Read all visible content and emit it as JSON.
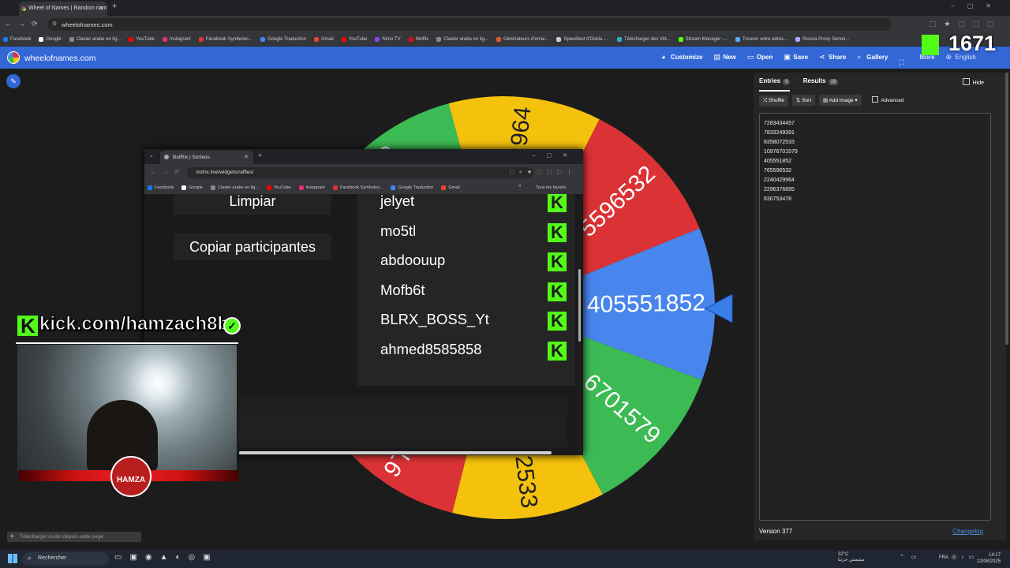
{
  "browser": {
    "tab_title": "Wheel of Names | Random nam",
    "url": "wheelofnames.com",
    "bookmarks": [
      {
        "label": "Facebook",
        "color": "#1877f2"
      },
      {
        "label": "Google",
        "color": "#ffffff"
      },
      {
        "label": "Clavier arabe en lig...",
        "color": "#888888"
      },
      {
        "label": "YouTube",
        "color": "#ff0000"
      },
      {
        "label": "Instagram",
        "color": "#e1306c"
      },
      {
        "label": "Facebook Symboles...",
        "color": "#d33"
      },
      {
        "label": "Google Traduction",
        "color": "#4285f4"
      },
      {
        "label": "Gmail",
        "color": "#ea4335"
      },
      {
        "label": "YouTube",
        "color": "#ff0000"
      },
      {
        "label": "Nimo TV",
        "color": "#8844ee"
      },
      {
        "label": "Netflix",
        "color": "#e50914"
      },
      {
        "label": "Clavier arabe en lig...",
        "color": "#888888"
      },
      {
        "label": "Générateurs d'emai...",
        "color": "#dd5533"
      },
      {
        "label": "Speedtest d'Ookla -...",
        "color": "#cccccc"
      },
      {
        "label": "Télécharger des Vid...",
        "color": "#33aacc"
      },
      {
        "label": "Stream Manager -...",
        "color": "#53fc18"
      },
      {
        "label": "Trouver votre adres...",
        "color": "#55aaff"
      },
      {
        "label": "Russia Proxy Server...",
        "color": "#aaaaff"
      }
    ]
  },
  "won": {
    "site": "wheelofnames.com",
    "menu": [
      {
        "label": "Customize",
        "icon": "palette-icon",
        "glyph": "◕"
      },
      {
        "label": "New",
        "icon": "file-icon",
        "glyph": "▤"
      },
      {
        "label": "Open",
        "icon": "folder-icon",
        "glyph": "▭"
      },
      {
        "label": "Save",
        "icon": "save-icon",
        "glyph": "▣"
      },
      {
        "label": "Share",
        "icon": "share-icon",
        "glyph": "⋖"
      },
      {
        "label": "Gallery",
        "icon": "search-icon",
        "glyph": "⌕"
      },
      {
        "label": "",
        "icon": "fullscreen-icon",
        "glyph": "⛶"
      },
      {
        "label": "More",
        "icon": "chevron-down-icon",
        "glyph": ""
      },
      {
        "label": "English",
        "icon": "globe-icon",
        "glyph": "⊕"
      }
    ],
    "kick_count": "1671"
  },
  "wheel": {
    "slices": [
      {
        "label": "7283434457",
        "color": "#db3236"
      },
      {
        "label": "7833249391",
        "color": "#f4c20d"
      },
      {
        "label": "8358072533",
        "color": "#3cba54"
      },
      {
        "label": "10976701579",
        "color": "#4885ed"
      },
      {
        "label": "405551852",
        "color": "#db3236"
      },
      {
        "label": "765596532",
        "color": "#f4c20d"
      },
      {
        "label": "2240429964",
        "color": "#3cba54"
      },
      {
        "label": "2296376895",
        "color": "#4885ed"
      },
      {
        "label": "830753478",
        "color": "#3cba54"
      }
    ],
    "winner": "405551852",
    "visible_fragments": {
      "top": "964",
      "left_top": "56",
      "red_right": "5596532",
      "blue_winner": "405551852",
      "green_right": "6701579",
      "bottom_yellow": "2533",
      "bottom_red": "L6"
    }
  },
  "panel": {
    "tab_entries": "Entries",
    "entries_count": "9",
    "tab_results": "Results",
    "results_count": "18",
    "hide": "Hide",
    "shuffle": "Shuffle",
    "sort": "Sort",
    "add_image": "Add image",
    "advanced": "Advanced",
    "entries": [
      "7283434457",
      "7833249391",
      "8358072533",
      "10976701579",
      "405551852",
      "765596532",
      "2240429964",
      "2296376895",
      "830753478"
    ],
    "version": "Version 377",
    "changelog": "Changelog"
  },
  "popup": {
    "tab_title": "BotRix | Sorteos",
    "url": "botrix.live/widgets/raffles/",
    "bookmarks": [
      {
        "label": "Facebook",
        "color": "#1877f2"
      },
      {
        "label": "Google",
        "color": "#ffffff"
      },
      {
        "label": "Clavier arabe en lig...",
        "color": "#888888"
      },
      {
        "label": "YouTube",
        "color": "#ff0000"
      },
      {
        "label": "Instagram",
        "color": "#e1306c"
      },
      {
        "label": "Facebook Symboles...",
        "color": "#d33"
      },
      {
        "label": "Google Traduction",
        "color": "#4285f4"
      },
      {
        "label": "Gmail",
        "color": "#ea4335"
      }
    ],
    "all_favorites": "Tous les favoris",
    "btn_clear": "Limpiar",
    "btn_copy": "Copiar participantes",
    "participants": [
      "jelyet",
      "mo5tl",
      "abdoouup",
      "Mofb6t",
      "BLRX_BOSS_Yt",
      "ahmed8585858"
    ]
  },
  "overlay": {
    "kick_url": "kick.com/hamzach8b",
    "logo_text": "HAMZA"
  },
  "download_hint": "Télécharger Audio depuis cette page",
  "taskbar": {
    "search": "Rechercher",
    "weather_temp": "32°C",
    "weather_desc": "مشمس جزئيا",
    "lang": "FRA",
    "time": "14:17",
    "date": "22/08/2025"
  },
  "colors": {
    "accent": "#3367d6",
    "kick_green": "#53fc18"
  }
}
